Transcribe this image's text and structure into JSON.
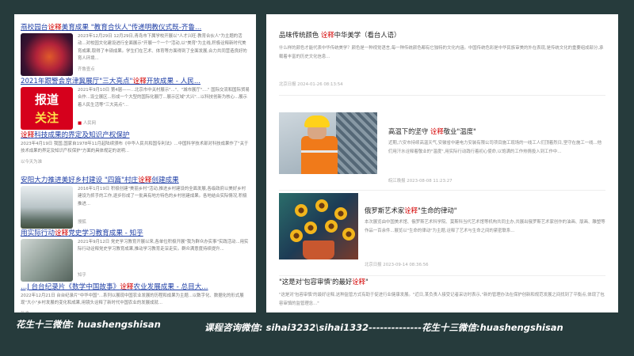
{
  "left": {
    "results": [
      {
        "title_pre": "燕校园台",
        "title_hl": "诠释",
        "title_post": "美育成果  \"教育合伙人\"传递明教仪式既-齐鲁...",
        "snippet": "2023年12月29日 12月29日,青岛市下属学校开展以\"人才兴旺·教育合伙人\"为主题的活动...对校园文化建设进行全面展示\"开展一个一个\"活动,以\"美育\"为主线,积极诠释新时代美育成果,取得了丰硕成果。学生们在艺术、体育等方面得到了全面发展,合力共同营造良好的育人环境...",
        "source": "齐鲁壹点"
      },
      {
        "title_pre": "2021年跟警会京津冀展厅\"三大亮点\"",
        "title_hl": "诠释",
        "title_post": "开放成果 - 人民...",
        "snippet": "2021年9月10日 第4届——...北京市中关村展示\"...\"、\"城市展厅\"....\" 国际交流和国际贸易合作...设立展区...形成一个大型的国际化展厅...展示区域\"大兴\"...以科技创新为核心...展示着人民生活等\"三大亮点\"...",
        "source": "人民网",
        "badge_line1": "报道",
        "badge_line2": "关注"
      },
      {
        "title_pre": "",
        "title_hl": "诠释",
        "title_post": "科技成果的界定及知识产权保护",
        "snippet": "2023年4月19日 我国,国家自1978年11月起陆续颁布《中华人民共和国专利法》...中国科学技术部对科技成果作了\"关于技术成果的界定及知识产权保护\"方面的具体规定的说明...",
        "source": "以今天为准"
      },
      {
        "title_pre": "安阳大力推进美好乡村建设 \"四篇\"村庄",
        "title_hl": "诠释",
        "title_post": "创建成果",
        "snippet": "2016年1月19日 积极创建\"美丽乡村\"活动,推进乡村建设的全面发展,各级政府以美好乡村建设为抓手的工作,逐步形成了一批具有地方特色的乡村创建成果。各地结合实际情况,积极推进...",
        "source": "搜狐"
      },
      {
        "title_pre": "用实际行动",
        "title_hl": "诠释",
        "title_post": "党史学习教育成果 - 知乎",
        "snippet": "2021年9月12日 党史学习教育开展以来,各单位积极开展\"我为群众办实事\"实践活动...用实际行动诠释党史学习教育成果,推动学习教育走深走实。群众满意度持续提升...",
        "source": "知乎"
      },
      {
        "title_pre": "...J 台台纪录片《数学中国故事》",
        "title_hl": "诠释",
        "title_post": "农业发展成果 - 总目大...",
        "snippet": "2022年12月21日 台台纪录片\"中华中国\"...系列以展现中国农业发展的历程和成果为主题...以数字化、数据化的形式展现\"大小\"乡村发展的变化和成果,用镜头诠释了新时代中国农业的发展成就...",
        "source": "新浪"
      }
    ]
  },
  "right": {
    "results": [
      {
        "title_pre": "品味传统颜色 ",
        "title_hl": "诠释",
        "title_post": "中华美学（看台人语）",
        "snippet": "什么样的颜色才能代表中华传统美学？颜色是一种视觉语言,每一种传统颜色都有它独特的文化内涵。中国传统色彩是中华民族审美的外在表现,是传统文化的重要组成部分,承载着丰富的历史文化信息...",
        "source": "北京日报",
        "date": "2024-01-26 08:13:54"
      },
      {
        "title_pre": "高温下的坚守 ",
        "title_hl": "诠释",
        "title_post": "敬业\"温度\"",
        "snippet": "近期,六安市持续高温天气,安徽省中建电力安装有限公司项目施工现场的一线工人们顶着烈日,坚守在施工一线...他们用汗水诠释着敬业的\"温度\",用实际行动践行着初心使命,以饱满的工作热情投入到工作中...",
        "source": "皖江晚报",
        "date": "2023-08-08 11:23:27"
      },
      {
        "title_pre": "俄罗斯艺术家",
        "title_hl": "诠释",
        "title_post": "\"生命的律动\"",
        "snippet": "本次展览由中国美术馆、俄罗斯艺术科学院、莫斯科当代艺术馆等机构共同主办,共展出俄罗斯艺术家创作的油画、版画、雕塑等作品一百余件...展览以\"生命的律动\"为主题,诠释了艺术与生命之间的紧密联系...",
        "source": "北京日报",
        "date": "2023-09-14 08:36:56"
      },
      {
        "title_pre": "\"这是对'包容审慎'的最好",
        "title_hl": "诠释",
        "title_post": "\"",
        "snippet": "\"这是对'包容审慎'的最好诠释,这种监管方式有助于促进行业健康发展。\"近日,某负责人接受记者采访时表示,\"新的管理办法在保护创新和规范发展之间找到了平衡点,体现了包容审慎的监管理念...\""
      }
    ]
  },
  "watermarks": {
    "left": "花生十三微信: huashengshisan",
    "bottom": "课程咨询微信: sihai3232\\sihai1332--------------花生十三微信:huashengshisan"
  }
}
